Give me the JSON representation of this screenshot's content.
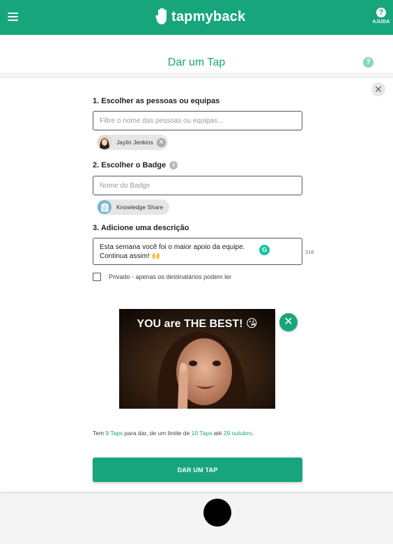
{
  "header": {
    "brand": "tapmyback",
    "help_label": "AJUDA",
    "help_glyph": "?"
  },
  "page": {
    "title": "Dar um Tap",
    "help_glyph": "?",
    "close_glyph": "✕"
  },
  "form": {
    "people": {
      "label": "1. Escolher as pessoas ou equipas",
      "placeholder": "Filtre o nome das pessoas ou equipas...",
      "selected": [
        {
          "name": "Jaylin Jenkins",
          "remove_glyph": "✕"
        }
      ]
    },
    "badge": {
      "label": "2. Escolher o Badge",
      "info_glyph": "i",
      "placeholder": "Nome do Badge",
      "selected": {
        "name": "Knowledge Share",
        "icon": "clipboard-icon"
      }
    },
    "description": {
      "label": "3. Adicione uma descrição",
      "line1": "Esta semana você foi o maior apoio da equipe.",
      "line2": "Continua assim! 🙌",
      "char_count": "216",
      "grammarly_glyph": "G"
    },
    "private_label": "Privado - apenas os destinatários podem ler",
    "private_checked": false,
    "gif": {
      "caption": "YOU are THE BEST! 😘",
      "remove_glyph": "✕"
    },
    "remaining": {
      "prefix": "Tem ",
      "taps_left": "9 Taps",
      "mid": " para dar, de um limite de ",
      "limit": "10 Taps",
      "until": " até ",
      "date": "29 outubro",
      "end": "."
    },
    "submit_label": "DAR UM TAP"
  },
  "colors": {
    "brand": "#17a57c",
    "grammarly": "#15c39a"
  }
}
